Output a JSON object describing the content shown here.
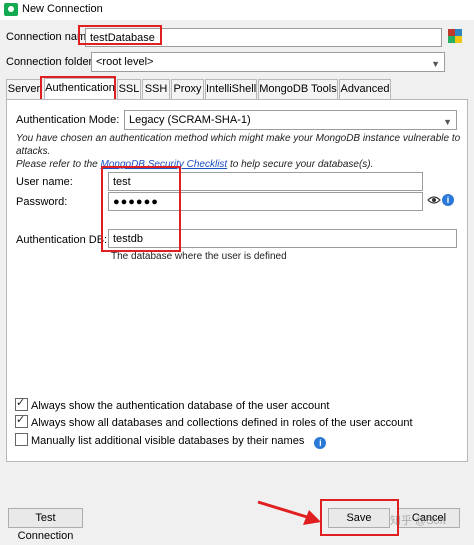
{
  "window": {
    "title": "New Connection"
  },
  "connection": {
    "name_label": "Connection name:",
    "name_value": "testDatabase",
    "folder_label": "Connection folder:",
    "folder_value": "<root level>"
  },
  "tabs": [
    {
      "label": "Server"
    },
    {
      "label": "Authentication"
    },
    {
      "label": "SSL"
    },
    {
      "label": "SSH"
    },
    {
      "label": "Proxy"
    },
    {
      "label": "IntelliShell"
    },
    {
      "label": "MongoDB Tools"
    },
    {
      "label": "Advanced"
    }
  ],
  "auth": {
    "mode_label": "Authentication Mode:",
    "mode_value": "Legacy (SCRAM-SHA-1)",
    "warning_line1": "You have chosen an authentication method which might make your MongoDB instance vulnerable to attacks.",
    "warning_line2_prefix": "Please refer to the ",
    "warning_link": "MongoDB Security Checklist",
    "warning_line2_suffix": " to help secure your database(s).",
    "username_label": "User name:",
    "username_value": "test",
    "password_label": "Password:",
    "password_value": "●●●●●●",
    "authdb_label": "Authentication DB:",
    "authdb_value": "testdb",
    "authdb_hint": "The database where the user is defined"
  },
  "options": [
    {
      "label": "Always show the authentication database of the user account",
      "checked": true
    },
    {
      "label": "Always show all databases and collections defined in roles of the user account",
      "checked": true
    },
    {
      "label": "Manually list additional visible databases by their names",
      "checked": false
    }
  ],
  "footer": {
    "test_label": "Test Connection",
    "save_label": "Save",
    "cancel_label": "Cancel",
    "watermark": "知乎 @Soft"
  },
  "colors": {
    "highlight": "#e02020",
    "link": "#1a4fc0",
    "info": "#2b79d6",
    "arrow": "#e02020"
  }
}
